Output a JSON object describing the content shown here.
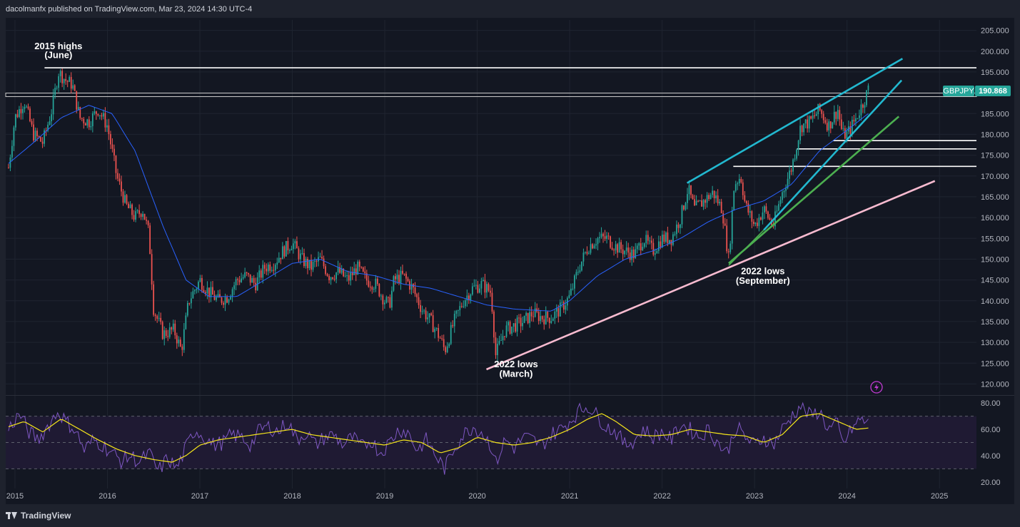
{
  "header": {
    "text": "dacolmanfx published on TradingView.com, Mar 23, 2024 14:30 UTC-4"
  },
  "footer": {
    "brand": "TradingView"
  },
  "colors": {
    "background": "#131722",
    "up": "#26a69a",
    "down": "#ef5350",
    "sma": "#2962ff",
    "rsi": "#7e57c2",
    "rsi_ma": "#f5e51b",
    "channel": "#22b8cf",
    "green_line": "#4caf50",
    "pink_line": "#f8bbd0",
    "level": "#ffffff"
  },
  "chart_data": [
    {
      "type": "candlestick",
      "symbol": "GBPJPY",
      "last_price": "190.868",
      "y_ticks": [
        "205.000",
        "200.000",
        "195.000",
        "190.000",
        "185.000",
        "180.000",
        "175.000",
        "170.000",
        "165.000",
        "160.000",
        "155.000",
        "150.000",
        "145.000",
        "140.000",
        "135.000",
        "130.000",
        "125.000",
        "120.000"
      ],
      "ylim": [
        117.5,
        207.5
      ],
      "x_ticks": [
        "2015",
        "2016",
        "2017",
        "2018",
        "2019",
        "2020",
        "2021",
        "2022",
        "2023",
        "2024",
        "2025"
      ],
      "xlim": [
        2014.9,
        2025.4
      ],
      "anchors": [
        [
          2014.93,
          172
        ],
        [
          2015.0,
          184
        ],
        [
          2015.1,
          188
        ],
        [
          2015.2,
          180
        ],
        [
          2015.3,
          178
        ],
        [
          2015.4,
          186
        ],
        [
          2015.47,
          195
        ],
        [
          2015.55,
          193
        ],
        [
          2015.62,
          192
        ],
        [
          2015.7,
          184
        ],
        [
          2015.8,
          183
        ],
        [
          2015.9,
          186
        ],
        [
          2016.0,
          182
        ],
        [
          2016.1,
          170
        ],
        [
          2016.2,
          163
        ],
        [
          2016.3,
          160
        ],
        [
          2016.38,
          162
        ],
        [
          2016.45,
          156
        ],
        [
          2016.5,
          138
        ],
        [
          2016.6,
          132
        ],
        [
          2016.72,
          133
        ],
        [
          2016.8,
          128
        ],
        [
          2016.88,
          140
        ],
        [
          2017.0,
          145
        ],
        [
          2017.1,
          142
        ],
        [
          2017.2,
          140
        ],
        [
          2017.3,
          141
        ],
        [
          2017.4,
          145
        ],
        [
          2017.5,
          146
        ],
        [
          2017.6,
          144
        ],
        [
          2017.7,
          148
        ],
        [
          2017.8,
          149
        ],
        [
          2017.9,
          152
        ],
        [
          2018.0,
          154
        ],
        [
          2018.1,
          150
        ],
        [
          2018.2,
          148
        ],
        [
          2018.3,
          150
        ],
        [
          2018.4,
          146
        ],
        [
          2018.5,
          147
        ],
        [
          2018.6,
          145
        ],
        [
          2018.7,
          148
        ],
        [
          2018.8,
          145
        ],
        [
          2018.9,
          144
        ],
        [
          2019.0,
          140
        ],
        [
          2019.05,
          139
        ],
        [
          2019.1,
          145
        ],
        [
          2019.2,
          146
        ],
        [
          2019.3,
          143
        ],
        [
          2019.4,
          138
        ],
        [
          2019.5,
          135
        ],
        [
          2019.6,
          131
        ],
        [
          2019.65,
          128
        ],
        [
          2019.75,
          135
        ],
        [
          2019.85,
          140
        ],
        [
          2019.95,
          143
        ],
        [
          2020.05,
          144
        ],
        [
          2020.15,
          142
        ],
        [
          2020.2,
          127
        ],
        [
          2020.3,
          133
        ],
        [
          2020.4,
          134
        ],
        [
          2020.5,
          135
        ],
        [
          2020.6,
          137
        ],
        [
          2020.7,
          136
        ],
        [
          2020.8,
          136
        ],
        [
          2020.9,
          138
        ],
        [
          2021.0,
          141
        ],
        [
          2021.1,
          148
        ],
        [
          2021.2,
          153
        ],
        [
          2021.3,
          155
        ],
        [
          2021.4,
          155
        ],
        [
          2021.5,
          153
        ],
        [
          2021.6,
          152
        ],
        [
          2021.7,
          151
        ],
        [
          2021.8,
          155
        ],
        [
          2021.9,
          152
        ],
        [
          2022.0,
          155
        ],
        [
          2022.1,
          155
        ],
        [
          2022.2,
          160
        ],
        [
          2022.28,
          167
        ],
        [
          2022.35,
          162
        ],
        [
          2022.45,
          164
        ],
        [
          2022.55,
          166
        ],
        [
          2022.65,
          162
        ],
        [
          2022.72,
          150
        ],
        [
          2022.78,
          168
        ],
        [
          2022.85,
          170
        ],
        [
          2022.9,
          163
        ],
        [
          2023.0,
          158
        ],
        [
          2023.1,
          162
        ],
        [
          2023.2,
          158
        ],
        [
          2023.3,
          166
        ],
        [
          2023.4,
          172
        ],
        [
          2023.5,
          182
        ],
        [
          2023.6,
          183
        ],
        [
          2023.7,
          186
        ],
        [
          2023.8,
          182
        ],
        [
          2023.9,
          186
        ],
        [
          2023.95,
          180
        ],
        [
          2024.0,
          180
        ],
        [
          2024.1,
          184
        ],
        [
          2024.2,
          189
        ],
        [
          2024.23,
          190.87
        ]
      ],
      "sma_anchors": [
        [
          2014.93,
          173
        ],
        [
          2015.2,
          178
        ],
        [
          2015.5,
          184
        ],
        [
          2015.8,
          187
        ],
        [
          2016.05,
          185
        ],
        [
          2016.3,
          176
        ],
        [
          2016.6,
          158
        ],
        [
          2016.85,
          145
        ],
        [
          2017.1,
          141
        ],
        [
          2017.4,
          141
        ],
        [
          2017.7,
          145
        ],
        [
          2018.0,
          149
        ],
        [
          2018.3,
          150
        ],
        [
          2018.6,
          147
        ],
        [
          2018.9,
          146
        ],
        [
          2019.2,
          144
        ],
        [
          2019.5,
          143
        ],
        [
          2019.8,
          141
        ],
        [
          2020.1,
          139
        ],
        [
          2020.4,
          138
        ],
        [
          2020.8,
          137.5
        ],
        [
          2021.0,
          140
        ],
        [
          2021.3,
          146
        ],
        [
          2021.6,
          150
        ],
        [
          2021.9,
          152
        ],
        [
          2022.2,
          155
        ],
        [
          2022.5,
          159
        ],
        [
          2022.8,
          162
        ],
        [
          2023.1,
          164
        ],
        [
          2023.4,
          168
        ],
        [
          2023.7,
          176
        ],
        [
          2024.0,
          181
        ],
        [
          2024.23,
          185
        ]
      ],
      "levels": [
        {
          "y": 196.0,
          "x0": 2015.32,
          "x1": 2025.4
        },
        {
          "y": 189.5,
          "x0": 2014.9,
          "x1": 2025.4,
          "band": true
        },
        {
          "y": 178.5,
          "x0": 2023.85,
          "x1": 2025.4
        },
        {
          "y": 176.5,
          "x0": 2023.46,
          "x1": 2025.4
        },
        {
          "y": 172.3,
          "x0": 2022.77,
          "x1": 2025.4
        }
      ],
      "trendlines": [
        {
          "name": "pink-support",
          "color": "#f8bbd0",
          "from": [
            2020.1,
            123.5
          ],
          "to": [
            2024.95,
            168.8
          ]
        },
        {
          "name": "upper-channel",
          "color": "#22b8cf",
          "from": [
            2022.27,
            168.3
          ],
          "to": [
            2024.6,
            198.2
          ]
        },
        {
          "name": "inner-channel",
          "color": "#22b8cf",
          "from": [
            2023.1,
            157.0
          ],
          "to": [
            2024.59,
            193.0
          ]
        },
        {
          "name": "green-support",
          "color": "#4caf50",
          "from": [
            2022.72,
            149.0
          ],
          "to": [
            2024.56,
            184.3
          ]
        },
        {
          "name": "sept-connector",
          "color": "#4caf50",
          "from": [
            2022.72,
            148.5
          ],
          "to": [
            2023.1,
            157.0
          ]
        }
      ],
      "annotations": [
        {
          "text": "2015 highs",
          "x": 2015.47,
          "y": 200.5
        },
        {
          "text": "(June)",
          "x": 2015.47,
          "y": 198.3
        },
        {
          "text": "2022 lows",
          "x": 2020.42,
          "y": 124.0
        },
        {
          "text": "(March)",
          "x": 2020.42,
          "y": 121.7
        },
        {
          "text": "2022 lows",
          "x": 2023.09,
          "y": 146.4
        },
        {
          "text": "(September)",
          "x": 2023.09,
          "y": 144.1
        }
      ]
    },
    {
      "type": "line",
      "name": "RSI",
      "y_ticks": [
        "80.00",
        "60.00",
        "40.00",
        "20.00"
      ],
      "ylim": [
        15,
        85
      ],
      "bands": [
        70,
        50,
        30
      ],
      "rsi_anchors": [
        [
          2014.93,
          60
        ],
        [
          2015.05,
          72
        ],
        [
          2015.15,
          58
        ],
        [
          2015.25,
          52
        ],
        [
          2015.35,
          62
        ],
        [
          2015.47,
          74
        ],
        [
          2015.55,
          66
        ],
        [
          2015.65,
          60
        ],
        [
          2015.75,
          44
        ],
        [
          2015.85,
          52
        ],
        [
          2015.95,
          48
        ],
        [
          2016.05,
          42
        ],
        [
          2016.15,
          36
        ],
        [
          2016.25,
          40
        ],
        [
          2016.35,
          35
        ],
        [
          2016.45,
          42
        ],
        [
          2016.55,
          28
        ],
        [
          2016.65,
          38
        ],
        [
          2016.75,
          30
        ],
        [
          2016.85,
          46
        ],
        [
          2016.95,
          60
        ],
        [
          2017.05,
          54
        ],
        [
          2017.15,
          48
        ],
        [
          2017.25,
          50
        ],
        [
          2017.35,
          56
        ],
        [
          2017.45,
          54
        ],
        [
          2017.55,
          48
        ],
        [
          2017.65,
          60
        ],
        [
          2017.75,
          62
        ],
        [
          2017.85,
          58
        ],
        [
          2017.95,
          66
        ],
        [
          2018.05,
          52
        ],
        [
          2018.15,
          58
        ],
        [
          2018.25,
          48
        ],
        [
          2018.35,
          54
        ],
        [
          2018.45,
          56
        ],
        [
          2018.55,
          48
        ],
        [
          2018.65,
          54
        ],
        [
          2018.75,
          46
        ],
        [
          2018.85,
          52
        ],
        [
          2018.95,
          42
        ],
        [
          2019.05,
          50
        ],
        [
          2019.15,
          60
        ],
        [
          2019.25,
          58
        ],
        [
          2019.35,
          44
        ],
        [
          2019.45,
          52
        ],
        [
          2019.55,
          40
        ],
        [
          2019.65,
          30
        ],
        [
          2019.75,
          46
        ],
        [
          2019.85,
          56
        ],
        [
          2019.95,
          62
        ],
        [
          2020.05,
          58
        ],
        [
          2020.15,
          48
        ],
        [
          2020.2,
          34
        ],
        [
          2020.3,
          52
        ],
        [
          2020.4,
          46
        ],
        [
          2020.5,
          54
        ],
        [
          2020.6,
          52
        ],
        [
          2020.7,
          48
        ],
        [
          2020.8,
          56
        ],
        [
          2020.9,
          60
        ],
        [
          2021.0,
          66
        ],
        [
          2021.1,
          74
        ],
        [
          2021.2,
          78
        ],
        [
          2021.3,
          70
        ],
        [
          2021.4,
          62
        ],
        [
          2021.5,
          58
        ],
        [
          2021.6,
          48
        ],
        [
          2021.7,
          52
        ],
        [
          2021.8,
          60
        ],
        [
          2021.9,
          54
        ],
        [
          2022.0,
          58
        ],
        [
          2022.1,
          52
        ],
        [
          2022.2,
          64
        ],
        [
          2022.3,
          60
        ],
        [
          2022.4,
          54
        ],
        [
          2022.5,
          60
        ],
        [
          2022.6,
          50
        ],
        [
          2022.7,
          42
        ],
        [
          2022.8,
          62
        ],
        [
          2022.9,
          54
        ],
        [
          2023.0,
          48
        ],
        [
          2023.1,
          54
        ],
        [
          2023.2,
          48
        ],
        [
          2023.3,
          60
        ],
        [
          2023.4,
          70
        ],
        [
          2023.5,
          78
        ],
        [
          2023.6,
          70
        ],
        [
          2023.7,
          74
        ],
        [
          2023.8,
          60
        ],
        [
          2023.9,
          64
        ],
        [
          2023.95,
          48
        ],
        [
          2024.05,
          60
        ],
        [
          2024.15,
          68
        ],
        [
          2024.23,
          64
        ]
      ],
      "ma_anchors": [
        [
          2014.93,
          62
        ],
        [
          2015.1,
          66
        ],
        [
          2015.3,
          58
        ],
        [
          2015.5,
          68
        ],
        [
          2015.7,
          60
        ],
        [
          2015.9,
          52
        ],
        [
          2016.1,
          45
        ],
        [
          2016.3,
          40
        ],
        [
          2016.5,
          37
        ],
        [
          2016.7,
          35
        ],
        [
          2016.85,
          40
        ],
        [
          2017.0,
          48
        ],
        [
          2017.2,
          52
        ],
        [
          2017.4,
          54
        ],
        [
          2017.6,
          56
        ],
        [
          2017.8,
          58
        ],
        [
          2018.0,
          60
        ],
        [
          2018.2,
          56
        ],
        [
          2018.4,
          54
        ],
        [
          2018.6,
          52
        ],
        [
          2018.8,
          50
        ],
        [
          2019.0,
          48
        ],
        [
          2019.2,
          52
        ],
        [
          2019.4,
          50
        ],
        [
          2019.6,
          42
        ],
        [
          2019.8,
          46
        ],
        [
          2020.0,
          54
        ],
        [
          2020.2,
          50
        ],
        [
          2020.4,
          48
        ],
        [
          2020.6,
          50
        ],
        [
          2020.8,
          54
        ],
        [
          2021.0,
          60
        ],
        [
          2021.2,
          68
        ],
        [
          2021.35,
          72
        ],
        [
          2021.5,
          66
        ],
        [
          2021.7,
          56
        ],
        [
          2021.9,
          55
        ],
        [
          2022.1,
          56
        ],
        [
          2022.3,
          60
        ],
        [
          2022.5,
          58
        ],
        [
          2022.7,
          56
        ],
        [
          2022.9,
          55
        ],
        [
          2023.1,
          50
        ],
        [
          2023.3,
          56
        ],
        [
          2023.5,
          70
        ],
        [
          2023.7,
          72
        ],
        [
          2023.9,
          66
        ],
        [
          2024.1,
          60
        ],
        [
          2024.23,
          61
        ]
      ]
    }
  ]
}
